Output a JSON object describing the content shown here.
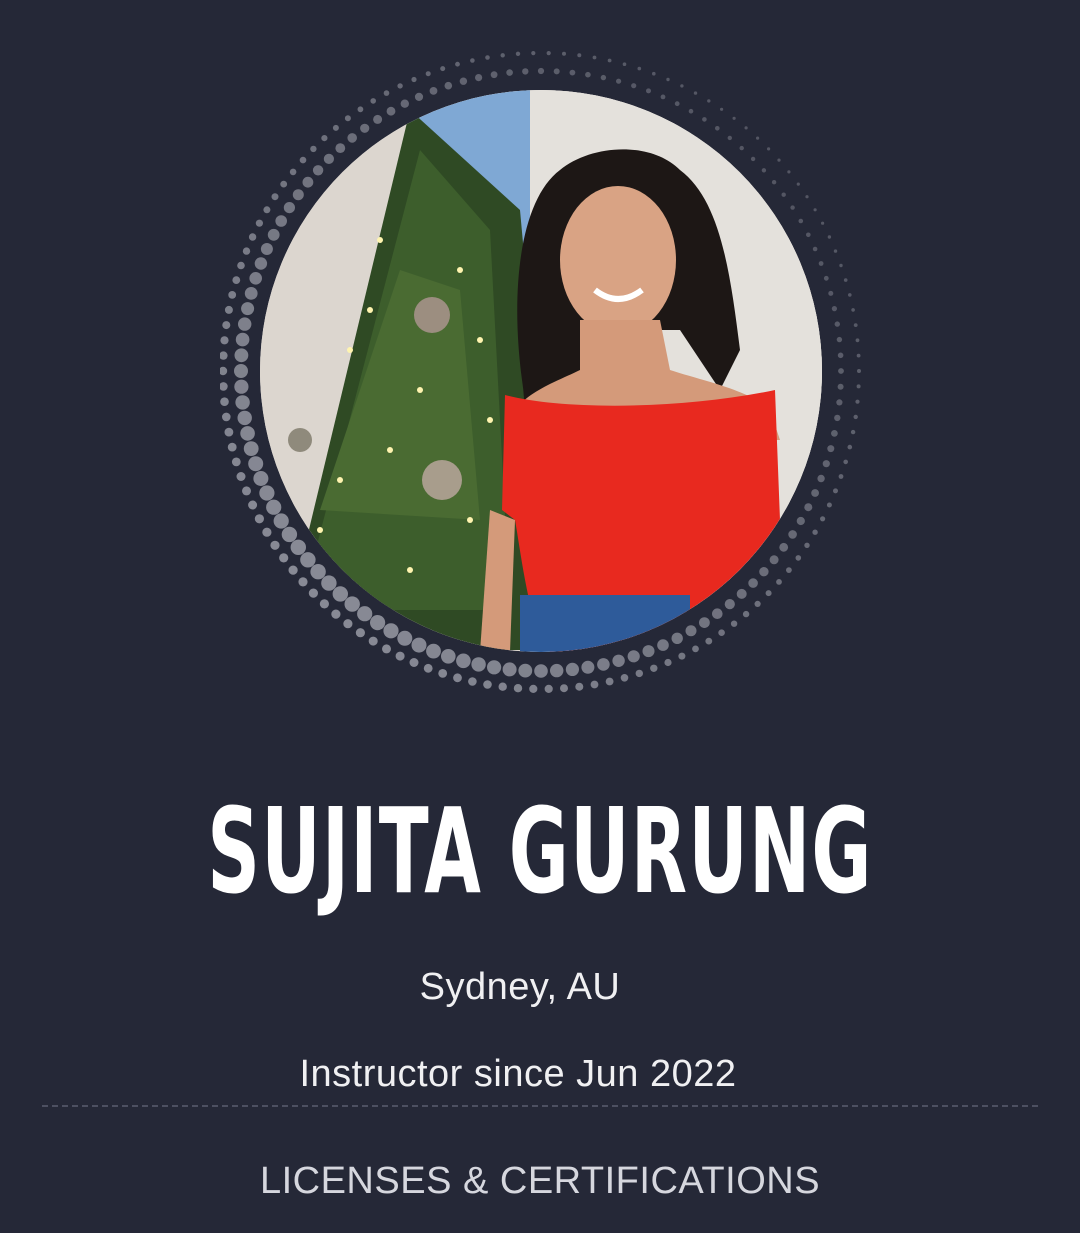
{
  "profile": {
    "name": "SUJITA GURUNG",
    "location": "Sydney, AU",
    "instructor_since": "Instructor since Jun 2022"
  },
  "sections": {
    "licenses_label": "LICENSES & CERTIFICATIONS"
  },
  "colors": {
    "background": "#252837",
    "text": "#ffffff",
    "ring_dots": "#8d8f9a",
    "divider": "#4d5061"
  }
}
